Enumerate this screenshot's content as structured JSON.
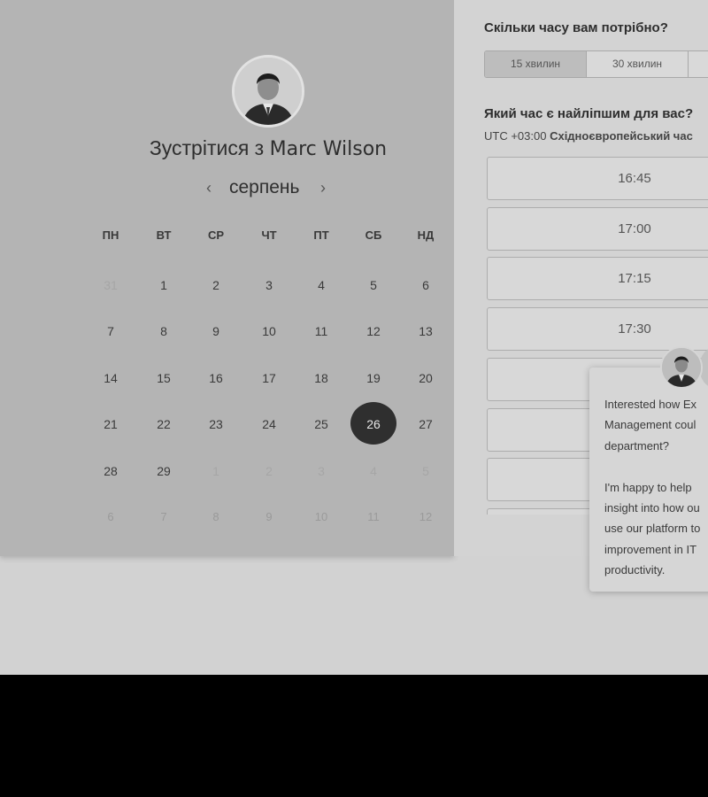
{
  "calendar": {
    "title_prefix": "Зустрітися з ",
    "host_name": "Marc Wilson",
    "month": "серпень",
    "prev_arrow": "‹",
    "next_arrow": "›",
    "weekdays": [
      "ПН",
      "ВТ",
      "СР",
      "ЧТ",
      "ПТ",
      "СБ",
      "НД"
    ],
    "weeks": [
      [
        "31",
        "1",
        "2",
        "3",
        "4",
        "5",
        "6"
      ],
      [
        "7",
        "8",
        "9",
        "10",
        "11",
        "12",
        "13"
      ],
      [
        "14",
        "15",
        "16",
        "17",
        "18",
        "19",
        "20"
      ],
      [
        "21",
        "22",
        "23",
        "24",
        "25",
        "26",
        "27"
      ],
      [
        "28",
        "29",
        "1",
        "2",
        "3",
        "4",
        "5"
      ],
      [
        "6",
        "7",
        "8",
        "9",
        "10",
        "11",
        "12"
      ]
    ],
    "selected_day": "26"
  },
  "booking": {
    "duration_question": "Скільки часу вам потрібно?",
    "durations": [
      "15 хвилин",
      "30 хвилин",
      ""
    ],
    "selected_duration": "15 хвилин",
    "time_question": "Який час є найліпшим для вас?",
    "timezone_offset": "UTC +03:00",
    "timezone_name": "Східноєвропейський час",
    "slots": [
      "16:45",
      "17:00",
      "17:15",
      "17:30",
      "",
      "",
      "",
      ""
    ]
  },
  "chat": {
    "message": "Interested how Ex\nManagement coul\ndepartment?\n\nI'm happy to help \ninsight into how ou\nuse our platform to\nimprovement in IT\nproductivity."
  },
  "colors": {
    "selected_day_bg": "#2f2f2f",
    "panel_bg": "#b4b4b4",
    "right_bg": "#d3d3d3"
  },
  "icons": [
    "avatar",
    "chevron-left-icon",
    "chevron-right-icon"
  ]
}
